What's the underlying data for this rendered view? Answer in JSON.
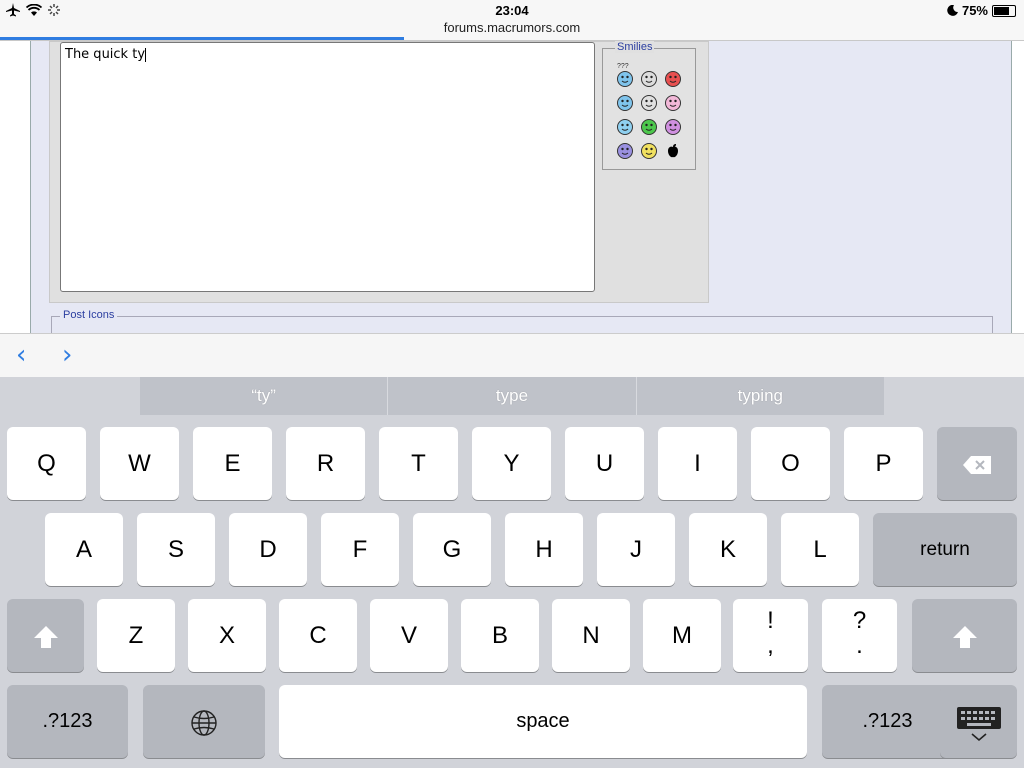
{
  "status": {
    "time": "23:04",
    "battery": "75%",
    "battery_level": 0.75,
    "airplane_icon": "airplane-icon",
    "wifi_icon": "wifi-icon",
    "activity_icon": "activity-spinner-icon",
    "moon_icon": "moon-icon"
  },
  "browser": {
    "url": "forums.macrumors.com",
    "load_progress": 0.395
  },
  "editor": {
    "text": "The quick ty"
  },
  "smilies": {
    "legend": "Smilies",
    "faces": [
      "confused-smiley",
      "eek-smiley",
      "mad-smiley",
      "rolleyes-smiley",
      "cool-smiley",
      "tongue-smiley",
      "wink-smiley",
      "grin-smiley",
      "pink-smiley",
      "frown-smiley",
      "smile-smiley",
      "apple-logo"
    ],
    "first_label": "???"
  },
  "post_icons": {
    "legend": "Post Icons"
  },
  "form_assist": {
    "prev": "‹",
    "next": "›"
  },
  "keyboard": {
    "suggestions": [
      "“ty”",
      "type",
      "typing"
    ],
    "row1": [
      "Q",
      "W",
      "E",
      "R",
      "T",
      "Y",
      "U",
      "I",
      "O",
      "P"
    ],
    "row2": [
      "A",
      "S",
      "D",
      "F",
      "G",
      "H",
      "J",
      "K",
      "L"
    ],
    "row3": [
      "Z",
      "X",
      "C",
      "V",
      "B",
      "N",
      "M"
    ],
    "excl": "!",
    "comma": ",",
    "question": "?",
    "period": ".",
    "return": "return",
    "space": "space",
    "numbers_left": ".?123",
    "numbers_right": ".?123",
    "backspace_icon": "backspace-icon",
    "shift_icon": "shift-icon",
    "globe_icon": "globe-icon",
    "hide_keyboard_icon": "hide-keyboard-icon"
  }
}
